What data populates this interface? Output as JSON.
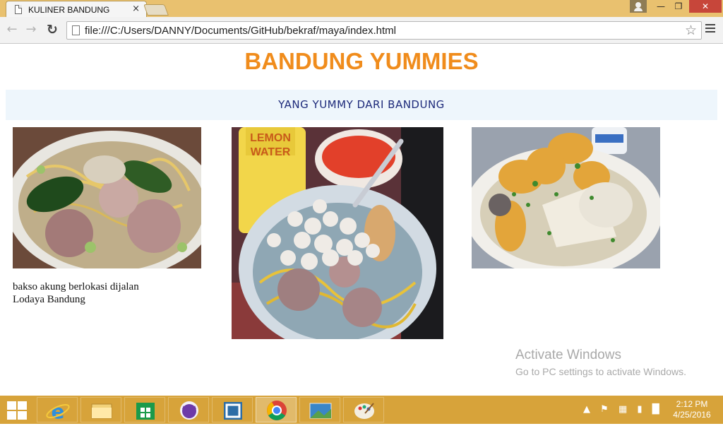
{
  "browser": {
    "tab_title": "KULINER BANDUNG",
    "tab_close": "×",
    "url": "file:///C:/Users/DANNY/Documents/GitHub/bekraf/maya/index.html",
    "icons": [
      "page-icon",
      "back-icon",
      "forward-icon",
      "reload-icon",
      "star-icon",
      "menu-icon",
      "close-icon",
      "minimize-icon",
      "maximize-icon",
      "user-icon"
    ],
    "window_controls": {
      "minimize": "—",
      "maximize": "❐",
      "close": "✕"
    }
  },
  "page": {
    "title": "BANDUNG YUMMIES",
    "tagline": "YANG YUMMY DARI BANDUNG",
    "title_color": "#f08c1c",
    "tagline_bg": "#eef6fc",
    "photos": [
      {
        "subject": "bowl of bakso with noodles and greens"
      },
      {
        "subject": "bowl of bakso with tiny meatballs, noodles and lemon water bottle"
      },
      {
        "subject": "bowl of siomay and fried tofu"
      }
    ],
    "caption": "bakso akung berlokasi dijalan Lodaya Bandung"
  },
  "watermark": {
    "line1": "Activate Windows",
    "line2": "Go to PC settings to activate Windows."
  },
  "taskbar": {
    "apps": [
      "internet-explorer",
      "file-explorer",
      "store",
      "cat-app",
      "app-window",
      "chrome",
      "photo-viewer",
      "paint"
    ],
    "active_app": "chrome",
    "clock_time": "2:12 PM",
    "clock_date": "4/25/2016",
    "accent": "#d7a33a"
  }
}
